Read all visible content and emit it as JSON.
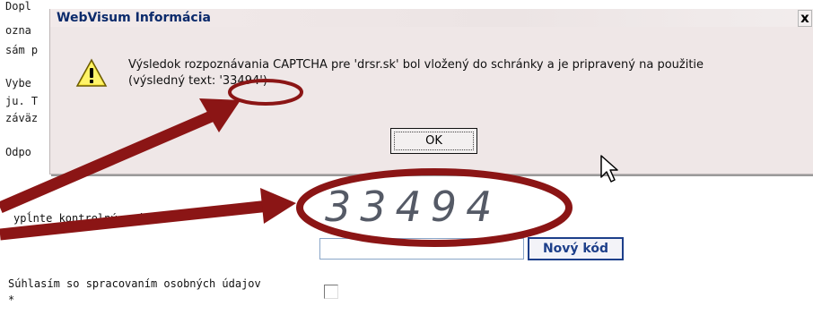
{
  "page": {
    "bg_lines": [
      "Dopl",
      "ozna",
      "sám p",
      "Vybe",
      "ju. T",
      "záväz",
      "Odpo"
    ],
    "captcha_label": "ypĺnte kontrolný reťazec *",
    "consent_label_line1": "Súhlasím so spracovaním osobných údajov",
    "consent_label_line2": "*",
    "new_code_label": "Nový kód",
    "captcha_image_text": "33494"
  },
  "dialog": {
    "title": "WebVisum Informácia",
    "close_label": "x",
    "message_line1": "Výsledok rozpoznávania CAPTCHA pre 'drsr.sk' bol vložený do schránky a je pripravený na použitie",
    "message_line2_prefix": "(výsledný text: ",
    "message_result": "'33494'",
    "message_line2_suffix": ")",
    "ok_label": "OK"
  },
  "colors": {
    "dialog_bg": "#efe7e7",
    "title_text": "#0b2a6b",
    "annotation": "#8b1515",
    "button_border": "#1d3f8a"
  },
  "icons": {
    "warning": "warning-triangle-icon",
    "cursor": "mouse-pointer-icon",
    "close": "close-icon"
  }
}
